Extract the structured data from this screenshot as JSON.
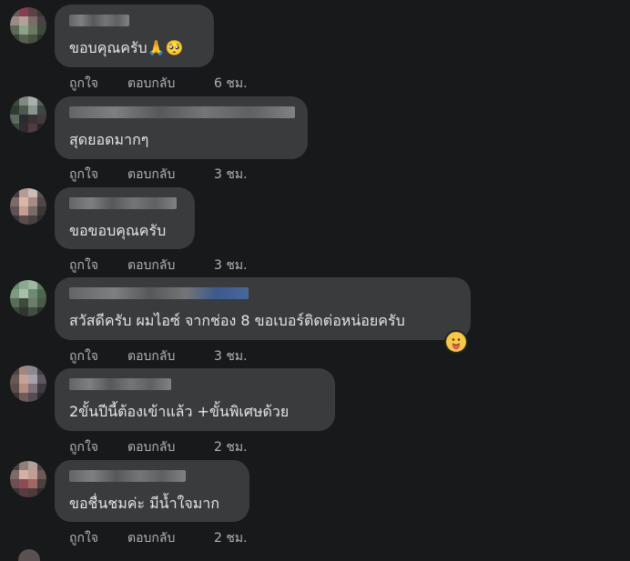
{
  "actions": {
    "like": "ถูกใจ",
    "reply": "ตอบกลับ"
  },
  "comments": [
    {
      "text": "ขอบคุณครับ",
      "emoji": "🙏🥺",
      "time": "6 ชม."
    },
    {
      "text": "สุดยอดมากๆ",
      "time": "3 ชม."
    },
    {
      "text": "ขอขอบคุณครับ",
      "time": "3 ชม."
    },
    {
      "text": "สวัสดีครับ ผมไอซ์ จากช่อง 8 ขอเบอร์ติดต่อหน่อยครับ",
      "time": "3 ชม.",
      "reaction": "care"
    },
    {
      "text": "2ขั้นปีนี้ต้องเข้าแล้ว +ขั้นพิเศษด้วย",
      "time": "2 ชม."
    },
    {
      "text": "ขอชื่นชมค่ะ มีน้ำใจมาก",
      "time": "2 ชม."
    }
  ]
}
